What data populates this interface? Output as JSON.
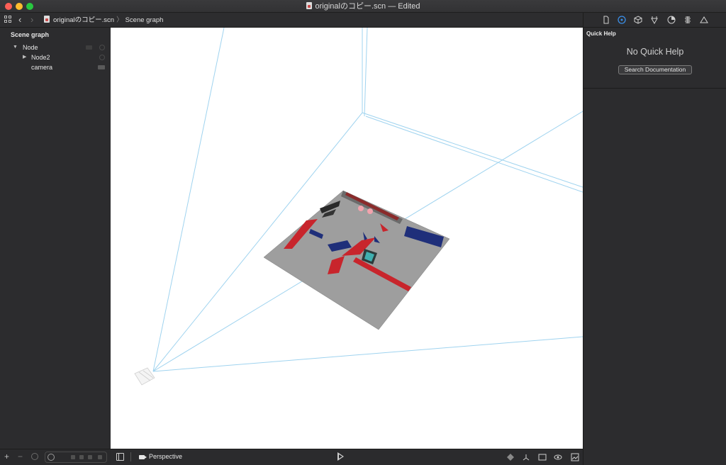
{
  "window": {
    "title": "originalのコピー.scn — Edited"
  },
  "toolbar": {
    "back_glyph": "‹",
    "forward_glyph": "›",
    "breadcrumb": [
      "originalのコピー.scn",
      "Scene graph"
    ],
    "breadcrumb_separator": "〉"
  },
  "scene_graph": {
    "header": "Scene graph",
    "nodes": [
      {
        "label": "Node",
        "expanded": true
      },
      {
        "label": "Node2",
        "expanded": false
      },
      {
        "label": "camera"
      }
    ]
  },
  "left_bottom": {
    "add_glyph": "+",
    "remove_glyph": "−"
  },
  "viewport_bar": {
    "camera_label": "Perspective"
  },
  "inspector": {
    "tabs": [
      "file-icon",
      "quick-help-icon",
      "node-icon",
      "attributes-icon",
      "material-icon",
      "physics-icon",
      "scene-icon"
    ],
    "active_tab": "quick-help-icon",
    "section_title": "Quick Help",
    "empty_message": "No Quick Help",
    "search_button": "Search Documentation"
  },
  "colors": {
    "accent": "#3b8ee6",
    "frustum_lines": "#9fd3ef",
    "floor": "#9e9e9e",
    "marking_red": "#c8252c",
    "marking_blue": "#1f2f7a"
  }
}
